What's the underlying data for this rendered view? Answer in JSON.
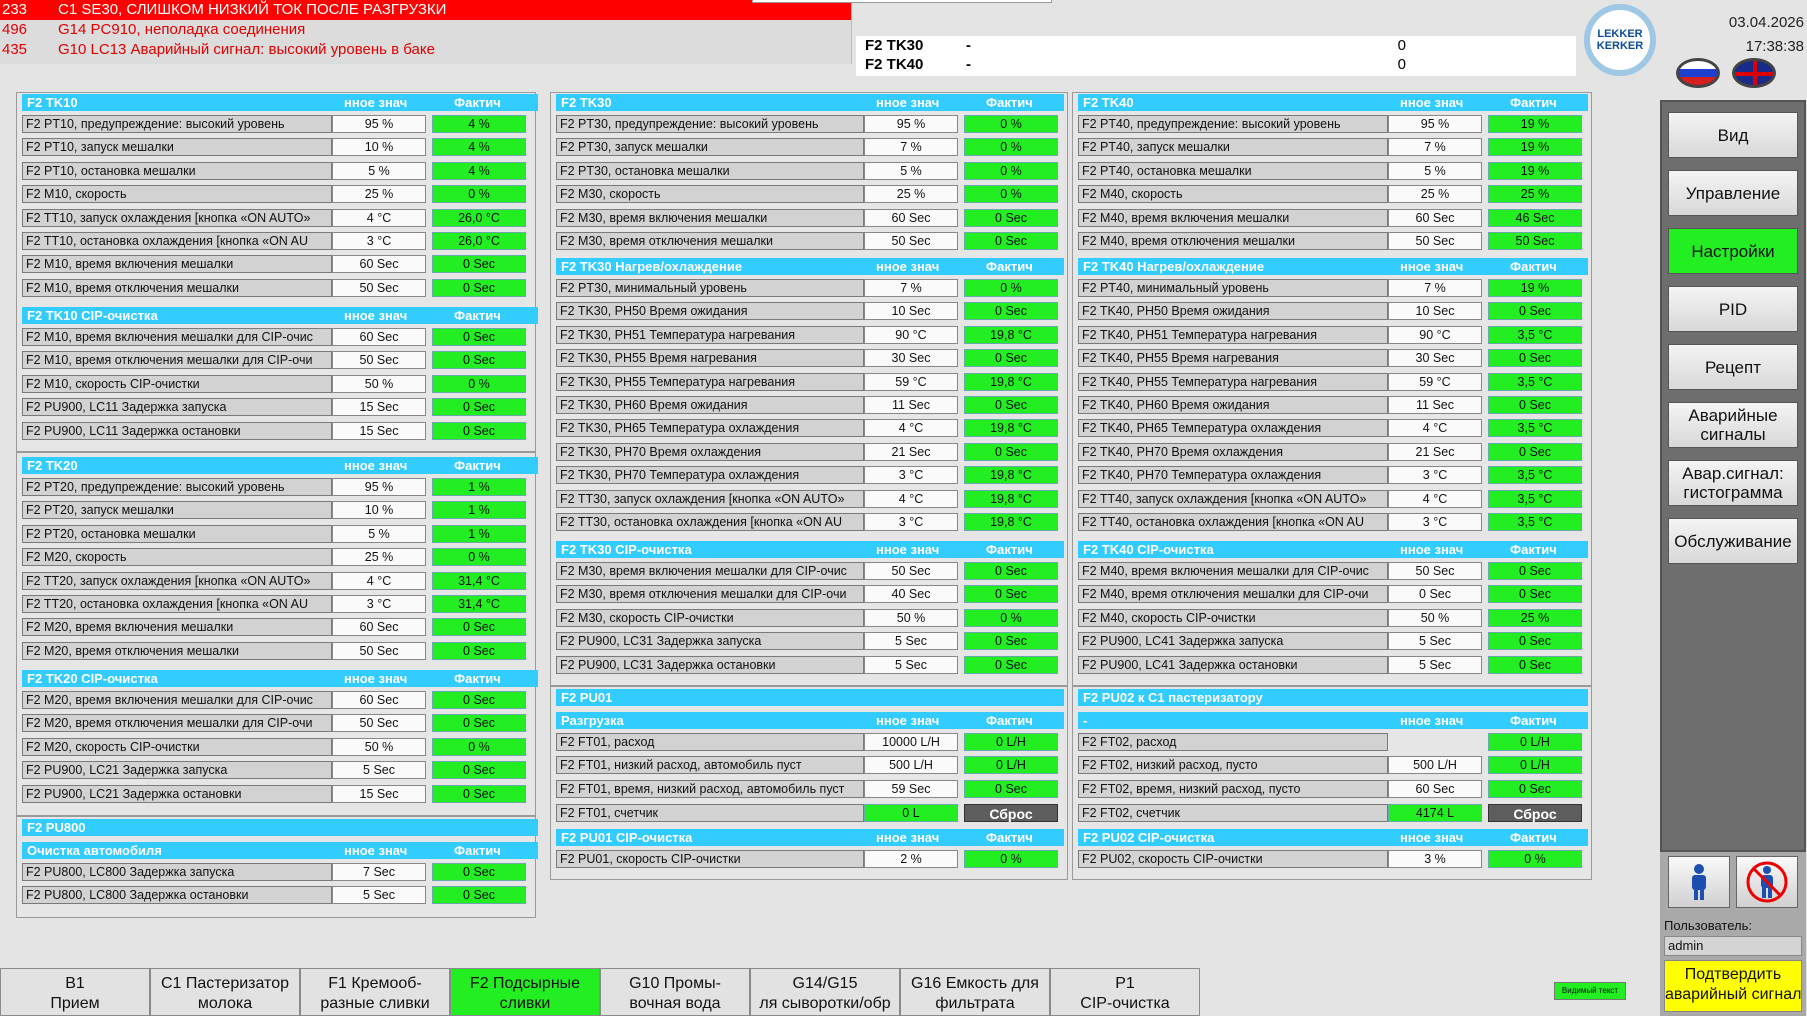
{
  "alarms": [
    {
      "code": "233",
      "text": "C1 SE30, СЛИШКОМ НИЗКИЙ ТОК ПОСЛЕ РАЗГРУЗКИ"
    },
    {
      "code": "496",
      "text": "G14 PC910, неполадка соединения"
    },
    {
      "code": "435",
      "text": "G10 LC13 Аварийный сигнал: высокий уровень в баке"
    }
  ],
  "tanks": [
    {
      "name": "F2 TK30",
      "dash": "-",
      "value": "0"
    },
    {
      "name": "F2 TK40",
      "dash": "-",
      "value": "0"
    }
  ],
  "logo": "LEKKER KERKER",
  "date": "03.04.2026",
  "time": "17:38:38",
  "colors": {
    "header": "#33ccff",
    "actual": "#22ee22",
    "alarm": "#ff0000",
    "confirm": "#ffff00"
  },
  "sp_label": "нное знач",
  "act_label": "Фактич",
  "reset_label": "Сброс",
  "tk10": {
    "title": "F2 TK10",
    "rows": [
      [
        "F2 PT10, предупреждение: высокий уровень",
        "95 %",
        "4 %"
      ],
      [
        "F2 PT10, запуск мешалки",
        "10 %",
        "4 %"
      ],
      [
        "F2 PT10, остановка мешалки",
        "5 %",
        "4 %"
      ],
      [
        "F2 M10, скорость",
        "25 %",
        "0 %"
      ],
      [
        "F2 TT10, запуск охлаждения [кнопка «ON AUTO»",
        "4 °C",
        "26,0 °C"
      ],
      [
        "F2 TT10, остановка охлаждения [кнопка «ON AU",
        "3 °C",
        "26,0 °C"
      ],
      [
        "F2 M10, время включения мешалки",
        "60 Sec",
        "0 Sec"
      ],
      [
        "F2 M10, время отключения мешалки",
        "50 Sec",
        "0 Sec"
      ]
    ]
  },
  "tk10cip": {
    "title": "F2 TK10 CIP-очистка",
    "rows": [
      [
        "F2 M10, время включения мешалки для CIP-очис",
        "60 Sec",
        "0 Sec"
      ],
      [
        "F2 M10, время отключения мешалки для CIP-очи",
        "50 Sec",
        "0 Sec"
      ],
      [
        "F2 M10, скорость CIP-очистки",
        "50 %",
        "0 %"
      ],
      [
        "F2 PU900, LC11 Задержка запуска",
        "15 Sec",
        "0 Sec"
      ],
      [
        "F2 PU900, LC11 Задержка остановки",
        "15 Sec",
        "0 Sec"
      ]
    ]
  },
  "tk20": {
    "title": "F2 TK20",
    "rows": [
      [
        "F2 PT20, предупреждение: высокий уровень",
        "95 %",
        "1 %"
      ],
      [
        "F2 PT20, запуск мешалки",
        "10 %",
        "1 %"
      ],
      [
        "F2 PT20, остановка мешалки",
        "5 %",
        "1 %"
      ],
      [
        "F2 M20, скорость",
        "25 %",
        "0 %"
      ],
      [
        "F2 TT20, запуск охлаждения [кнопка «ON AUTO»",
        "4 °C",
        "31,4 °C"
      ],
      [
        "F2 TT20, остановка охлаждения [кнопка «ON AU",
        "3 °C",
        "31,4 °C"
      ],
      [
        "F2 M20, время включения мешалки",
        "60 Sec",
        "0 Sec"
      ],
      [
        "F2 M20, время отключения мешалки",
        "50 Sec",
        "0 Sec"
      ]
    ]
  },
  "tk20cip": {
    "title": "F2 TK20 CIP-очистка",
    "rows": [
      [
        "F2 M20, время включения мешалки для CIP-очис",
        "60 Sec",
        "0 Sec"
      ],
      [
        "F2 M20, время отключения мешалки для CIP-очи",
        "50 Sec",
        "0 Sec"
      ],
      [
        "F2 M20, скорость CIP-очистки",
        "50 %",
        "0 %"
      ],
      [
        "F2 PU900, LC21 Задержка запуска",
        "5 Sec",
        "0 Sec"
      ],
      [
        "F2 PU900, LC21 Задержка остановки",
        "15 Sec",
        "0 Sec"
      ]
    ]
  },
  "pu800": {
    "title": "F2 PU800"
  },
  "pu800sub": {
    "title": "Очистка автомобиля",
    "rows": [
      [
        "F2 PU800, LC800 Задержка запуска",
        "7 Sec",
        "0 Sec"
      ],
      [
        "F2 PU800, LC800 Задержка остановки",
        "5 Sec",
        "0 Sec"
      ]
    ]
  },
  "tk30": {
    "title": "F2 TK30",
    "rows": [
      [
        "F2 PT30, предупреждение: высокий уровень",
        "95 %",
        "0 %"
      ],
      [
        "F2 PT30, запуск мешалки",
        "7 %",
        "0 %"
      ],
      [
        "F2 PT30, остановка мешалки",
        "5 %",
        "0 %"
      ],
      [
        "F2 M30, скорость",
        "25 %",
        "0 %"
      ],
      [
        "F2 M30, время включения мешалки",
        "60 Sec",
        "0 Sec"
      ],
      [
        "F2 M30, время отключения мешалки",
        "50 Sec",
        "0 Sec"
      ]
    ]
  },
  "tk30h": {
    "title": "F2 TK30 Нагрев/охлаждение",
    "rows": [
      [
        "F2 PT30, минимальный уровень",
        "7 %",
        "0 %"
      ],
      [
        "F2 TK30, PH50 Время ожидания",
        "10 Sec",
        "0 Sec"
      ],
      [
        "F2 TK30, PH51 Температура нагревания",
        "90 °C",
        "19,8 °C"
      ],
      [
        "F2 TK30, PH55 Время нагревания",
        "30 Sec",
        "0 Sec"
      ],
      [
        "F2 TK30, PH55 Температура нагревания",
        "59 °C",
        "19,8 °C"
      ],
      [
        "F2 TK30, PH60 Время ожидания",
        "11 Sec",
        "0 Sec"
      ],
      [
        "F2 TK30, PH65 Температура охлаждения",
        "4 °C",
        "19,8 °C"
      ],
      [
        "F2 TK30, PH70 Время охлаждения",
        "21 Sec",
        "0 Sec"
      ],
      [
        "F2 TK30, PH70 Температура охлаждения",
        "3 °C",
        "19,8 °C"
      ],
      [
        "F2 TT30, запуск охлаждения [кнопка «ON AUTO»",
        "4 °C",
        "19,8 °C"
      ],
      [
        "F2 TT30, остановка охлаждения [кнопка «ON AU",
        "3 °C",
        "19,8 °C"
      ]
    ]
  },
  "tk30cip": {
    "title": "F2 TK30 CIP-очистка",
    "rows": [
      [
        "F2 M30, время включения мешалки для CIP-очис",
        "50 Sec",
        "0 Sec"
      ],
      [
        "F2 M30, время отключения мешалки для CIP-очи",
        "40 Sec",
        "0 Sec"
      ],
      [
        "F2 M30, скорость CIP-очистки",
        "50 %",
        "0 %"
      ],
      [
        "F2 PU900, LC31 Задержка запуска",
        "5 Sec",
        "0 Sec"
      ],
      [
        "F2 PU900, LC31 Задержка остановки",
        "5 Sec",
        "0 Sec"
      ]
    ]
  },
  "tk40": {
    "title": "F2 TK40",
    "rows": [
      [
        "F2 PT40, предупреждение: высокий уровень",
        "95 %",
        "19 %"
      ],
      [
        "F2 PT40, запуск мешалки",
        "7 %",
        "19 %"
      ],
      [
        "F2 PT40, остановка мешалки",
        "5 %",
        "19 %"
      ],
      [
        "F2 M40, скорость",
        "25 %",
        "25 %"
      ],
      [
        "F2 M40, время включения мешалки",
        "60 Sec",
        "46 Sec"
      ],
      [
        "F2 M40, время отключения мешалки",
        "50 Sec",
        "50 Sec"
      ]
    ]
  },
  "tk40h": {
    "title": "F2 TK40 Нагрев/охлаждение",
    "rows": [
      [
        "F2 PT40, минимальный уровень",
        "7 %",
        "19 %"
      ],
      [
        "F2 TK40, PH50 Время ожидания",
        "10 Sec",
        "0 Sec"
      ],
      [
        "F2 TK40, PH51 Температура нагревания",
        "90 °C",
        "3,5 °C"
      ],
      [
        "F2 TK40, PH55 Время нагревания",
        "30 Sec",
        "0 Sec"
      ],
      [
        "F2 TK40, PH55 Температура нагревания",
        "59 °C",
        "3,5 °C"
      ],
      [
        "F2 TK40, PH60 Время ожидания",
        "11 Sec",
        "0 Sec"
      ],
      [
        "F2 TK40, PH65 Температура охлаждения",
        "4 °C",
        "3,5 °C"
      ],
      [
        "F2 TK40, PH70 Время охлаждения",
        "21 Sec",
        "0 Sec"
      ],
      [
        "F2 TK40, PH70 Температура охлаждения",
        "3 °C",
        "3,5 °C"
      ],
      [
        "F2 TT40, запуск охлаждения [кнопка «ON AUTO»",
        "4 °C",
        "3,5 °C"
      ],
      [
        "F2 TT40, остановка охлаждения [кнопка «ON AU",
        "3 °C",
        "3,5 °C"
      ]
    ]
  },
  "tk40cip": {
    "title": "F2 TK40 CIP-очистка",
    "rows": [
      [
        "F2 M40, время включения мешалки для CIP-очис",
        "50 Sec",
        "0 Sec"
      ],
      [
        "F2 M40, время отключения мешалки для CIP-очи",
        "0 Sec",
        "0 Sec"
      ],
      [
        "F2 M40, скорость CIP-очистки",
        "50 %",
        "25 %"
      ],
      [
        "F2 PU900, LC41 Задержка запуска",
        "5 Sec",
        "0 Sec"
      ],
      [
        "F2 PU900, LC41 Задержка остановки",
        "5 Sec",
        "0 Sec"
      ]
    ]
  },
  "pu01": {
    "title": "F2 PU01"
  },
  "pu01sub": {
    "title": "Разгрузка",
    "rows": [
      [
        "F2 FT01, расход",
        "10000 L/H",
        "0 L/H"
      ],
      [
        "F2 FT01, низкий расход, автомобиль пуст",
        "500 L/H",
        "0 L/H"
      ],
      [
        "F2 FT01, время, низкий расход, автомобиль пуст",
        "59 Sec",
        "0 Sec"
      ]
    ]
  },
  "pu01counter": {
    "label": "F2 FT01, счетчик",
    "value": "0 L"
  },
  "pu01cip": {
    "title": "F2 PU01 CIP-очистка",
    "rows": [
      [
        "F2 PU01, скорость CIP-очистки",
        "2 %",
        "0 %"
      ]
    ]
  },
  "pu02": {
    "title": "F2 PU02 к C1 пастеризатору"
  },
  "pu02sub": {
    "title": "-",
    "rows": [
      [
        "F2 FT02, расход",
        "",
        "0 L/H"
      ],
      [
        "F2 FT02, низкий расход, пусто",
        "500 L/H",
        "0 L/H"
      ],
      [
        "F2 FT02, время, низкий расход, пусто",
        "60 Sec",
        "0 Sec"
      ]
    ]
  },
  "pu02counter": {
    "label": "F2 FT02, счетчик",
    "value": "4174 L"
  },
  "pu02cip": {
    "title": "F2 PU02 CIP-очистка",
    "rows": [
      [
        "F2 PU02, скорость CIP-очистки",
        "3 %",
        "0 %"
      ]
    ]
  },
  "menu": [
    "Вид",
    "Управление",
    "Настройки",
    "PID",
    "Рецепт",
    "Аварийные\nсигналы",
    "Авар.сигнал:\nгистограмма",
    "Обслуживание"
  ],
  "menu_active": 2,
  "user": {
    "label": "Пользователь:",
    "name": "admin",
    "confirm": "Подтвердить\nаварийный сигнал"
  },
  "tabs": [
    "B1\nПрием",
    "C1 Пастеризатор\nмолока",
    "F1 Кремооб-\nразные сливки",
    "F2 Подсырные\nсливки",
    "G10 Промы-\nвочная вода",
    "G14/G15\nля сыворотки/обр",
    "G16 Емкость для\nфильтрата",
    "P1\nCIP-очистка"
  ],
  "tab_active": 3,
  "tiny_label": "Видимый текст"
}
